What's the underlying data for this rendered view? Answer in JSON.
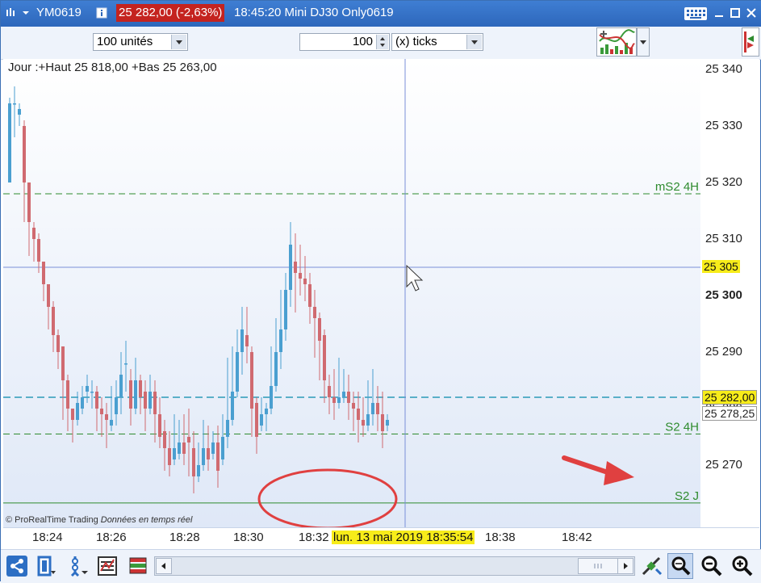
{
  "title": {
    "symbol": "YM0619",
    "price_change": "25 282,00 (-2,63%)",
    "time_and_name": "18:45:20 Mini DJ30 Only0619"
  },
  "toolbar": {
    "units_select": "100 unités",
    "ticks_value": "100",
    "ticks_select": "(x) ticks"
  },
  "chart": {
    "info_line": "Jour :+Haut 25 818,00 +Bas 25 263,00",
    "copyright": "© ProRealTime Trading",
    "realtime_label": "Données en temps réel",
    "levels": [
      {
        "label": "mS2 4H",
        "value": 25318
      },
      {
        "label": "S2 4H",
        "value": 25275.5
      },
      {
        "label": "S2 J",
        "value": 25263.3
      }
    ],
    "current_price_line": 25282,
    "crosshair_price": 25305,
    "price_ticks": [
      "25 340",
      "25 330",
      "25 320",
      "25 310",
      "25 300",
      "25 290",
      "25 280",
      "25 270"
    ],
    "price_tags": {
      "crosshair": "25 305",
      "last": "25 282,00",
      "other": "25 278,25"
    },
    "time_ticks": [
      "18:24",
      "18:26",
      "18:28",
      "18:30",
      "18:32",
      "18:38",
      "18:42"
    ],
    "crosshair_time": "lun. 13 mai 2019 18:35:54",
    "colors": {
      "up": "#4a9fd0",
      "down": "#d06a70",
      "level_line": "#2e8b2e",
      "price_line": "#2a9ab8",
      "crosshair": "#7a8fd8",
      "annotation": "#e04040"
    }
  },
  "chart_data": {
    "type": "candlestick",
    "ylim": [
      25262,
      25342
    ],
    "candles": [
      [
        25320,
        25334,
        25323,
        25335
      ],
      [
        25334,
        25334,
        25328,
        25337
      ],
      [
        25332,
        25333,
        25330,
        25334
      ],
      [
        25330,
        25320,
        25313,
        25331
      ],
      [
        25320,
        25313,
        25307,
        25320
      ],
      [
        25312,
        25310,
        25306,
        25313
      ],
      [
        25310,
        25306,
        25304,
        25311
      ],
      [
        25306,
        25302,
        25299,
        25306
      ],
      [
        25302,
        25298,
        25294,
        25302
      ],
      [
        25298,
        25293,
        25290,
        25299
      ],
      [
        25293,
        25290,
        25287,
        25294
      ],
      [
        25291,
        25285,
        25278,
        25291
      ],
      [
        25285,
        25280,
        25276,
        25286
      ],
      [
        25280,
        25278,
        25274,
        25280
      ],
      [
        25278,
        25281,
        25277,
        25283
      ],
      [
        25280,
        25282,
        25279,
        25284
      ],
      [
        25283,
        25284,
        25281,
        25286
      ],
      [
        25283,
        25283,
        25280,
        25285
      ],
      [
        25283,
        25280,
        25276,
        25284
      ],
      [
        25280,
        25279,
        25275,
        25282
      ],
      [
        25279,
        25278,
        25273,
        25281
      ],
      [
        25277,
        25278,
        25276,
        25284
      ],
      [
        25279,
        25282,
        25277,
        25285
      ],
      [
        25282,
        25286,
        25279,
        25290
      ],
      [
        25288,
        25288,
        25283,
        25292
      ],
      [
        25285,
        25280,
        25277,
        25287
      ],
      [
        25280,
        25285,
        25279,
        25289
      ],
      [
        25285,
        25282,
        25279,
        25286
      ],
      [
        25283,
        25280,
        25276,
        25285
      ],
      [
        25280,
        25283,
        25279,
        25286
      ],
      [
        25283,
        25279,
        25274,
        25285
      ],
      [
        25279,
        25275,
        25273,
        25282
      ],
      [
        25276,
        25273,
        25269,
        25278
      ],
      [
        25273,
        25270,
        25268,
        25276
      ],
      [
        25271,
        25273,
        25270,
        25279
      ],
      [
        25272,
        25274,
        25271,
        25278
      ],
      [
        25274,
        25272,
        25270,
        25279
      ],
      [
        25275,
        25274,
        25268,
        25280
      ],
      [
        25273,
        25268,
        25265,
        25276
      ],
      [
        25268,
        25270,
        25267,
        25274
      ],
      [
        25270,
        25273,
        25269,
        25278
      ],
      [
        25273,
        25271,
        25269,
        25277
      ],
      [
        25272,
        25274,
        25271,
        25276
      ],
      [
        25274,
        25269,
        25266,
        25277
      ],
      [
        25271,
        25275,
        25270,
        25279
      ],
      [
        25275,
        25278,
        25273,
        25289
      ],
      [
        25278,
        25283,
        25277,
        25291
      ],
      [
        25283,
        25290,
        25282,
        25294
      ],
      [
        25290,
        25294,
        25286,
        25298
      ],
      [
        25293,
        25291,
        25288,
        25298
      ],
      [
        25290,
        25280,
        25275,
        25291
      ],
      [
        25281,
        25275,
        25272,
        25282
      ],
      [
        25277,
        25279,
        25276,
        25282
      ],
      [
        25279,
        25280,
        25276,
        25281
      ],
      [
        25280,
        25284,
        25279,
        25291
      ],
      [
        25284,
        25290,
        25283,
        25296
      ],
      [
        25290,
        25294,
        25287,
        25301
      ],
      [
        25294,
        25301,
        25292,
        25304
      ],
      [
        25301,
        25309,
        25298,
        25313
      ],
      [
        25306,
        25304,
        25297,
        25311
      ],
      [
        25304,
        25303,
        25300,
        25309
      ],
      [
        25303,
        25302,
        25299,
        25307
      ],
      [
        25302,
        25298,
        25295,
        25304
      ],
      [
        25298,
        25296,
        25289,
        25301
      ],
      [
        25296,
        25292,
        25285,
        25297
      ],
      [
        25293,
        25285,
        25281,
        25294
      ],
      [
        25284,
        25282,
        25279,
        25286
      ],
      [
        25282,
        25281,
        25278,
        25287
      ],
      [
        25281,
        25282,
        25280,
        25289
      ],
      [
        25282,
        25283,
        25281,
        25287
      ],
      [
        25283,
        25281,
        25278,
        25286
      ],
      [
        25281,
        25280,
        25276,
        25283
      ],
      [
        25280,
        25278,
        25274,
        25283
      ],
      [
        25278,
        25277,
        25275,
        25282
      ],
      [
        25277,
        25279,
        25276,
        25285
      ],
      [
        25279,
        25281,
        25277,
        25287
      ],
      [
        25281,
        25279,
        25276,
        25284
      ],
      [
        25279,
        25276,
        25273,
        25283
      ],
      [
        25277,
        25278,
        25276,
        25279
      ]
    ]
  },
  "bottombar": {
    "icons": [
      "share-icon",
      "layout-icon",
      "drawing-tools-icon",
      "indicators-icon",
      "orders-icon"
    ],
    "right_icons": [
      "cursor-tool-icon",
      "zoom-select-icon",
      "zoom-out-icon",
      "zoom-in-icon"
    ]
  }
}
